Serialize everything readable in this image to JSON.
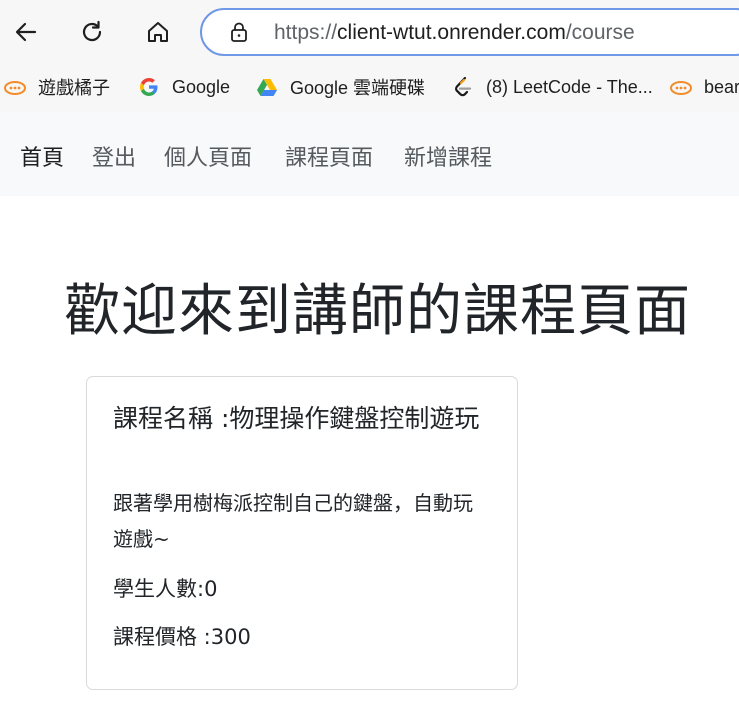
{
  "browser": {
    "url_scheme": "https://",
    "url_host": "client-wtut.onrender.com",
    "url_path": "/course",
    "bookmarks": [
      {
        "label": "遊戲橘子",
        "icon": "orange-game-icon"
      },
      {
        "label": "Google",
        "icon": "google-icon"
      },
      {
        "label": "Google 雲端硬碟",
        "icon": "google-drive-icon"
      },
      {
        "label": "(8) LeetCode - The...",
        "icon": "leetcode-icon"
      },
      {
        "label": "bear",
        "icon": "orange-game-icon"
      }
    ]
  },
  "nav": {
    "items": [
      "首頁",
      "登出",
      "個人頁面",
      "課程頁面",
      "新增課程"
    ]
  },
  "page": {
    "title": "歡迎來到講師的課程頁面"
  },
  "course": {
    "name_text": "課程名稱 :物理操作鍵盤控制遊玩",
    "description": "跟著學用樹梅派控制自己的鍵盤，自動玩遊戲~",
    "students_text": "學生人數:0",
    "price_text": "課程價格 :300"
  },
  "colors": {
    "address_border": "#6f98e6",
    "nav_bg": "#f8f9fa",
    "card_border": "#d8dadc"
  }
}
